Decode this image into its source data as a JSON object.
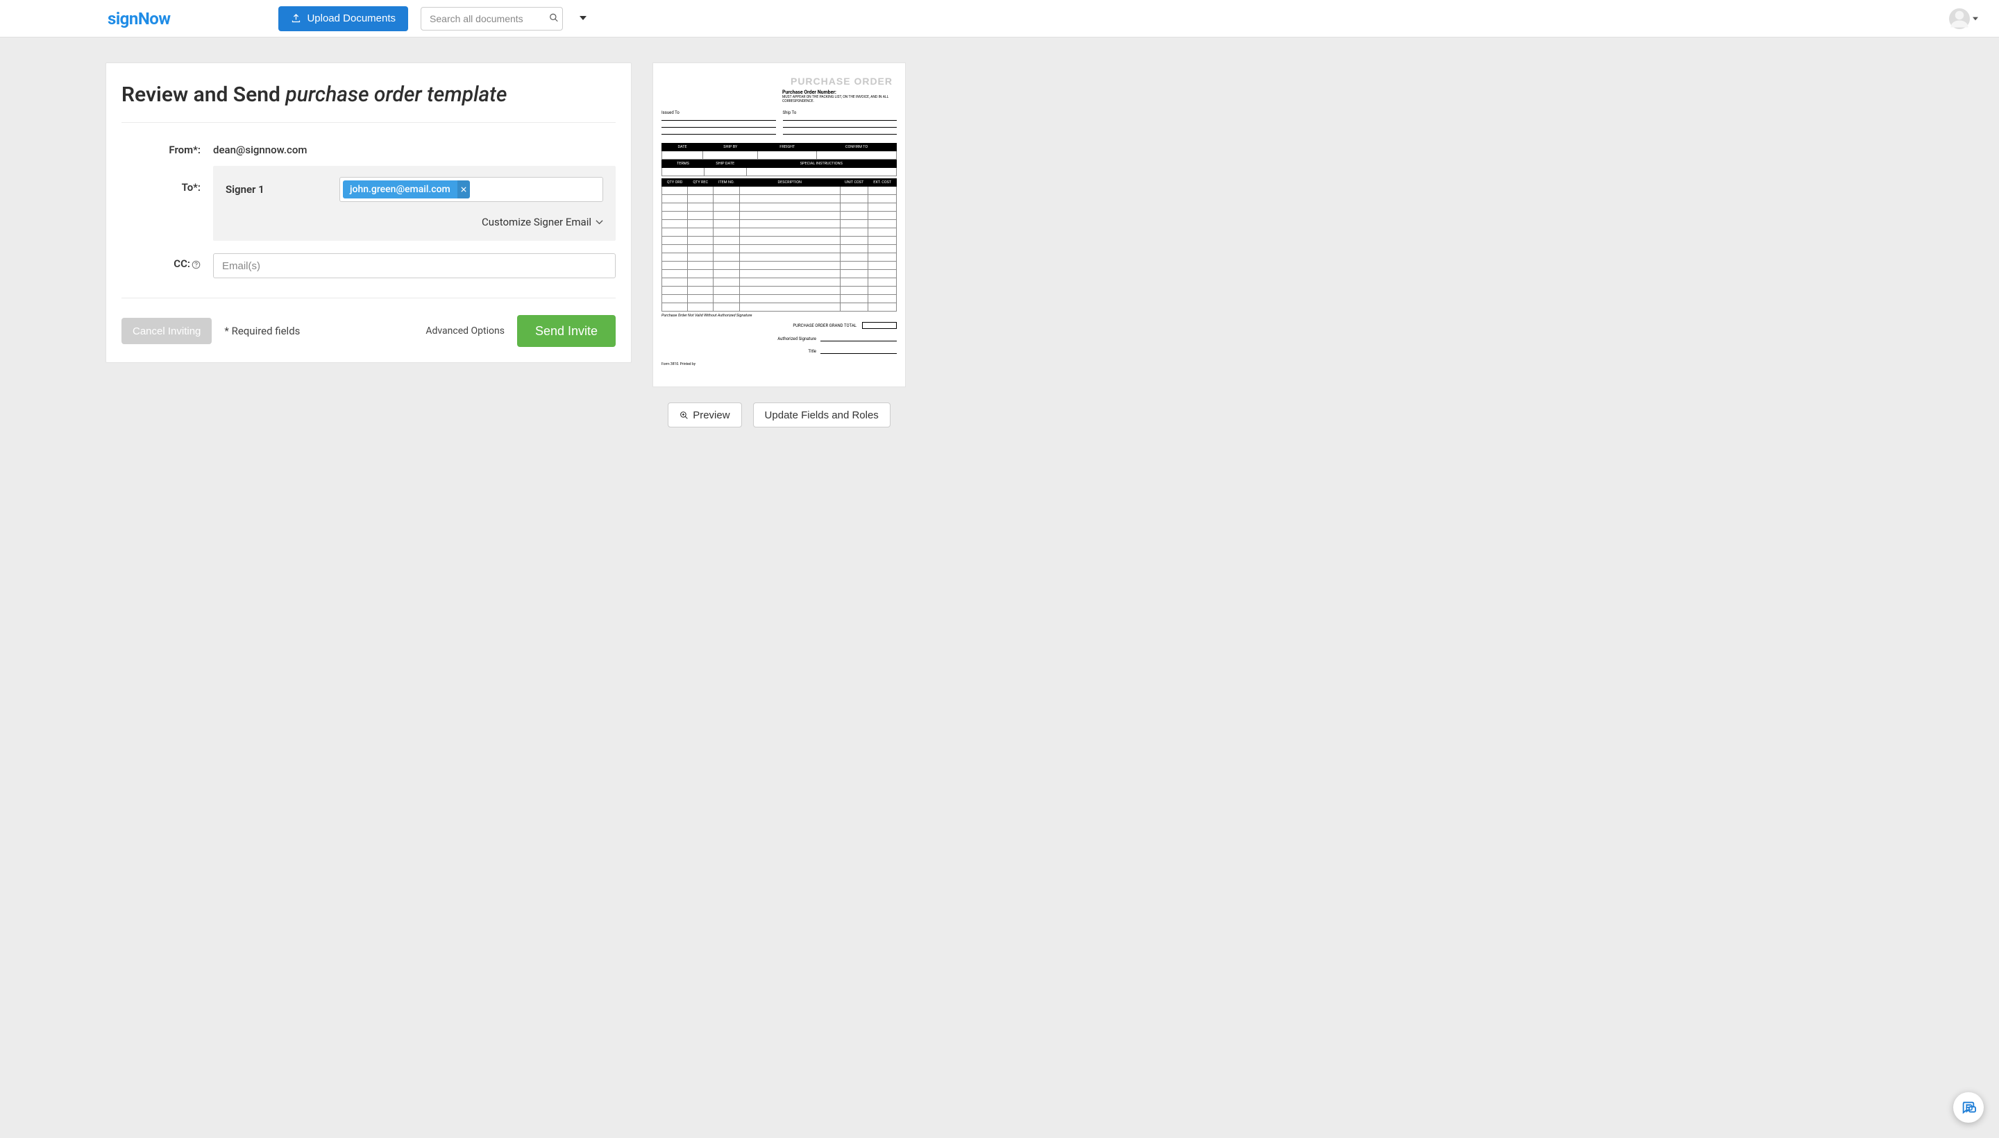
{
  "brand": "signNow",
  "header": {
    "upload_label": "Upload Documents",
    "search_placeholder": "Search all documents"
  },
  "main": {
    "title_prefix": "Review and Send ",
    "document_name": "purchase order template",
    "from_label": "From*:",
    "from_value": "dean@signnow.com",
    "to_label": "To*:",
    "signer_label": "Signer 1",
    "signer_email": "john.green@email.com",
    "customize_label": "Customize Signer Email",
    "cc_label": "CC:",
    "cc_placeholder": "Email(s)",
    "cancel_label": "Cancel Inviting",
    "required_note": "* Required fields",
    "advanced_label": "Advanced Options",
    "send_label": "Send Invite"
  },
  "preview": {
    "title": "PURCHASE ORDER",
    "po_number_label": "Purchase Order Number:",
    "po_note": "MUST APPEAR ON THE PACKING LIST, ON THE INVOICE, AND IN ALL CORRESPONDENCE.",
    "issued_to_label": "Issued To",
    "ship_to_label": "Ship To",
    "row1_headers": [
      "DATE",
      "SHIP BY",
      "FREIGHT",
      "CONFIRM TO"
    ],
    "row2_headers": [
      "TERMS",
      "SHIP DATE",
      "SPECIAL INSTRUCTIONS"
    ],
    "item_headers": [
      "QTY ORD",
      "QTY REC",
      "ITEM NO.",
      "DESCRIPTION",
      "UNIT COST",
      "EXT. COST"
    ],
    "not_valid_note": "Purchase Order Not Valid Without Authorized Signature",
    "grand_total_label": "PURCHASE ORDER GRAND TOTAL",
    "auth_sig_label": "Authorized Signature",
    "title_label": "Title",
    "form_note": "Form 3810. Printed by",
    "preview_btn": "Preview",
    "update_btn": "Update Fields and Roles"
  }
}
